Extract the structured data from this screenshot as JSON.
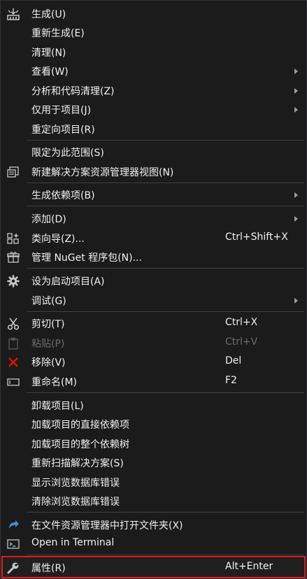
{
  "menu": {
    "items": [
      {
        "label": "生成(U)"
      },
      {
        "label": "重新生成(E)"
      },
      {
        "label": "清理(N)"
      },
      {
        "label": "查看(W)"
      },
      {
        "label": "分析和代码清理(Z)"
      },
      {
        "label": "仅用于项目(J)"
      },
      {
        "label": "重定向项目(R)"
      },
      {
        "label": "限定为此范围(S)"
      },
      {
        "label": "新建解决方案资源管理器视图(N)"
      },
      {
        "label": "生成依赖项(B)"
      },
      {
        "label": "添加(D)"
      },
      {
        "label": "类向导(Z)...",
        "shortcut": "Ctrl+Shift+X"
      },
      {
        "label": "管理 NuGet 程序包(N)..."
      },
      {
        "label": "设为启动项目(A)"
      },
      {
        "label": "调试(G)"
      },
      {
        "label": "剪切(T)",
        "shortcut": "Ctrl+X"
      },
      {
        "label": "粘贴(P)",
        "shortcut": "Ctrl+V"
      },
      {
        "label": "移除(V)",
        "shortcut": "Del"
      },
      {
        "label": "重命名(M)",
        "shortcut": "F2"
      },
      {
        "label": "卸载项目(L)"
      },
      {
        "label": "加载项目的直接依赖项"
      },
      {
        "label": "加载项目的整个依赖树"
      },
      {
        "label": "重新扫描解决方案(S)"
      },
      {
        "label": "显示浏览数据库错误"
      },
      {
        "label": "清除浏览数据库错误"
      },
      {
        "label": "在文件资源管理器中打开文件夹(X)"
      },
      {
        "label": "Open in Terminal"
      },
      {
        "label": "属性(R)",
        "shortcut": "Alt+Enter"
      }
    ]
  },
  "colors": {
    "background": "#1b1b1c",
    "text": "#f1f1f1",
    "disabled_text": "#6d6d6d",
    "separator": "#3f3f46",
    "highlight_border": "#e01c1c",
    "remove_icon": "#e51400",
    "open_folder_icon": "#3c8fdd"
  },
  "icons": {
    "build": "build-icon",
    "new_view": "solution-explorer-view-icon",
    "class_wizard": "class-wizard-icon",
    "nuget": "nuget-package-icon",
    "startup": "gear-icon",
    "cut": "scissors-icon",
    "paste": "clipboard-icon",
    "remove": "red-x-icon",
    "rename": "rename-icon",
    "open_folder": "open-folder-arrow-icon",
    "terminal": "terminal-icon",
    "properties": "wrench-icon"
  }
}
